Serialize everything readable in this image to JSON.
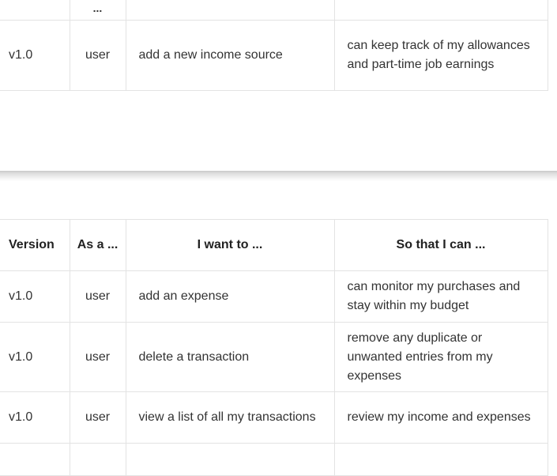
{
  "top_table": {
    "fragment_header": {
      "col2": "..."
    },
    "rows": [
      {
        "version": "v1.0",
        "as_a": "user",
        "i_want_to": "add a new income source",
        "so_that": "can keep track of my allowances and part-time job earnings"
      }
    ]
  },
  "bottom_table": {
    "headers": {
      "version": "Version",
      "as_a": "As a ...",
      "i_want_to": "I want to ...",
      "so_that": "So that I can ..."
    },
    "rows": [
      {
        "version": "v1.0",
        "as_a": "user",
        "i_want_to": "add an expense",
        "so_that": "can monitor my purchases and stay within my budget"
      },
      {
        "version": "v1.0",
        "as_a": "user",
        "i_want_to": "delete a transaction",
        "so_that": "remove any duplicate or unwanted entries from my expenses"
      },
      {
        "version": "v1.0",
        "as_a": "user",
        "i_want_to": "view a list of all my transactions",
        "so_that": "review my income and expenses"
      },
      {
        "version": "",
        "as_a": "",
        "i_want_to": "",
        "so_that": ""
      }
    ]
  }
}
